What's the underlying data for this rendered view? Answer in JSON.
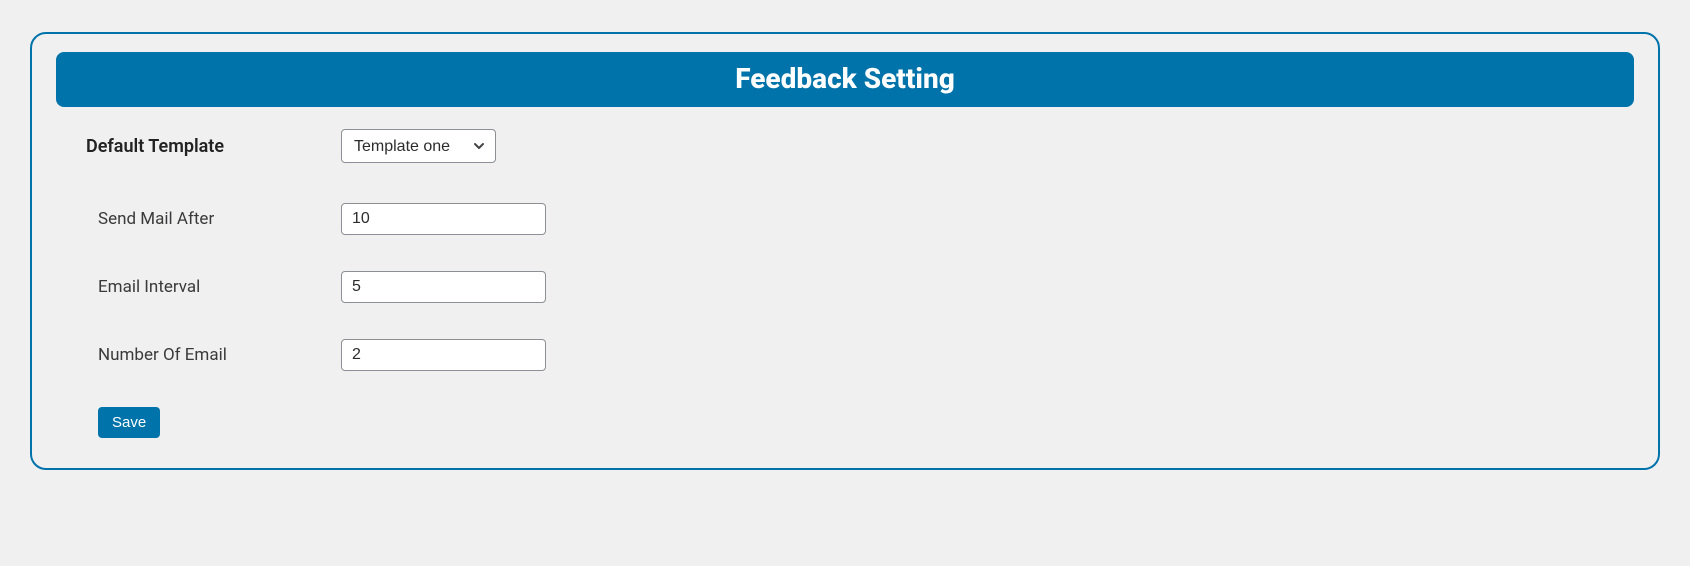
{
  "header": {
    "title": "Feedback Setting"
  },
  "form": {
    "default_template": {
      "label": "Default Template",
      "selected": "Template one"
    },
    "send_mail_after": {
      "label": "Send Mail After",
      "value": "10"
    },
    "email_interval": {
      "label": "Email Interval",
      "value": "5"
    },
    "number_of_email": {
      "label": "Number Of Email",
      "value": "2"
    },
    "save_label": "Save"
  }
}
